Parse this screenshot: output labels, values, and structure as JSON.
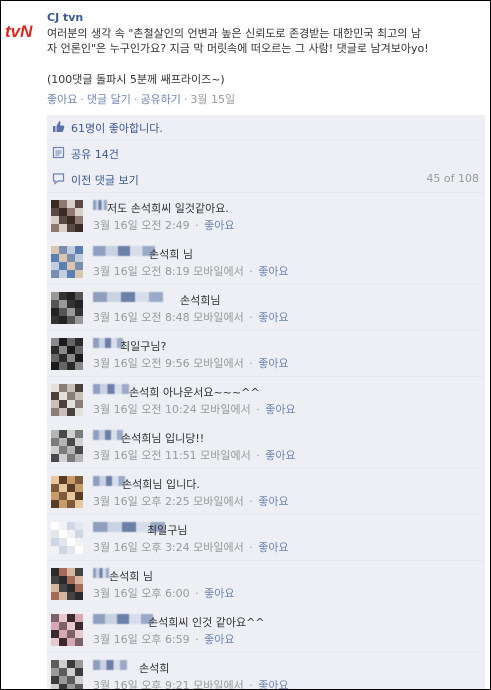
{
  "post": {
    "page_name": "CJ tvn",
    "logo_text": "tvN",
    "text_lines": [
      "여러분의 생각 속 \"촌철살인의 언변과 높은 신뢰도로 존경받는 대한민국 최고의 남",
      "자 언론인\"은 누구인가요? 지금 막 머릿속에 떠오르는 그 사람! 댓글로 남겨보아yo!"
    ],
    "sub_text": "(100댓글 돌파시 5분께 쌔프라이즈~)",
    "actions": {
      "like": "좋아요",
      "comment": "댓글 달기",
      "share": "공유하기",
      "date": "3월 15일"
    }
  },
  "likes_bar": {
    "text": "61명이 좋아합니다."
  },
  "shares_bar": {
    "text": "공유 14건"
  },
  "prev_comments_bar": {
    "text": "이전 댓글 보기",
    "count": "45 of 108"
  },
  "comments": [
    {
      "text": "저도 손석희씨 일것같아요.",
      "time": "3월 16일 오전 2:49",
      "source": "",
      "like": "좋아요"
    },
    {
      "text": "손석희 님",
      "time": "3월 16일 오전 8:19",
      "source": "모바일에서",
      "like": "좋아요"
    },
    {
      "text": "손석희님",
      "time": "3월 16일 오전 8:48",
      "source": "모바일에서",
      "like": "좋아요"
    },
    {
      "text": "최일구님?",
      "time": "3월 16일 오전 9:56",
      "source": "모바일에서",
      "like": "좋아요"
    },
    {
      "text": "손석희 아나운서요~~~^^",
      "time": "3월 16일 오전 10:24",
      "source": "모바일에서",
      "like": "좋아요"
    },
    {
      "text": "손석희님 입니당!!",
      "time": "3월 16일 오전 11:51",
      "source": "모바일에서",
      "like": "좋아요"
    },
    {
      "text": "손석희님 입니다.",
      "time": "3월 16일 오후 2:25",
      "source": "모바일에서",
      "like": "좋아요"
    },
    {
      "text": "최일구님",
      "time": "3월 16일 오후 3:24",
      "source": "모바일에서",
      "like": "좋아요"
    },
    {
      "text": "손석희 님",
      "time": "3월 16일 오후 6:00",
      "source": "",
      "like": "좋아요"
    },
    {
      "text": "손석희씨 인것 같아요^^",
      "time": "3월 16일 오후 6:59",
      "source": "",
      "like": "좋아요"
    },
    {
      "text": "손석희",
      "time": "3월 16일 오후 9:21",
      "source": "모바일에서",
      "like": "좋아요"
    }
  ]
}
